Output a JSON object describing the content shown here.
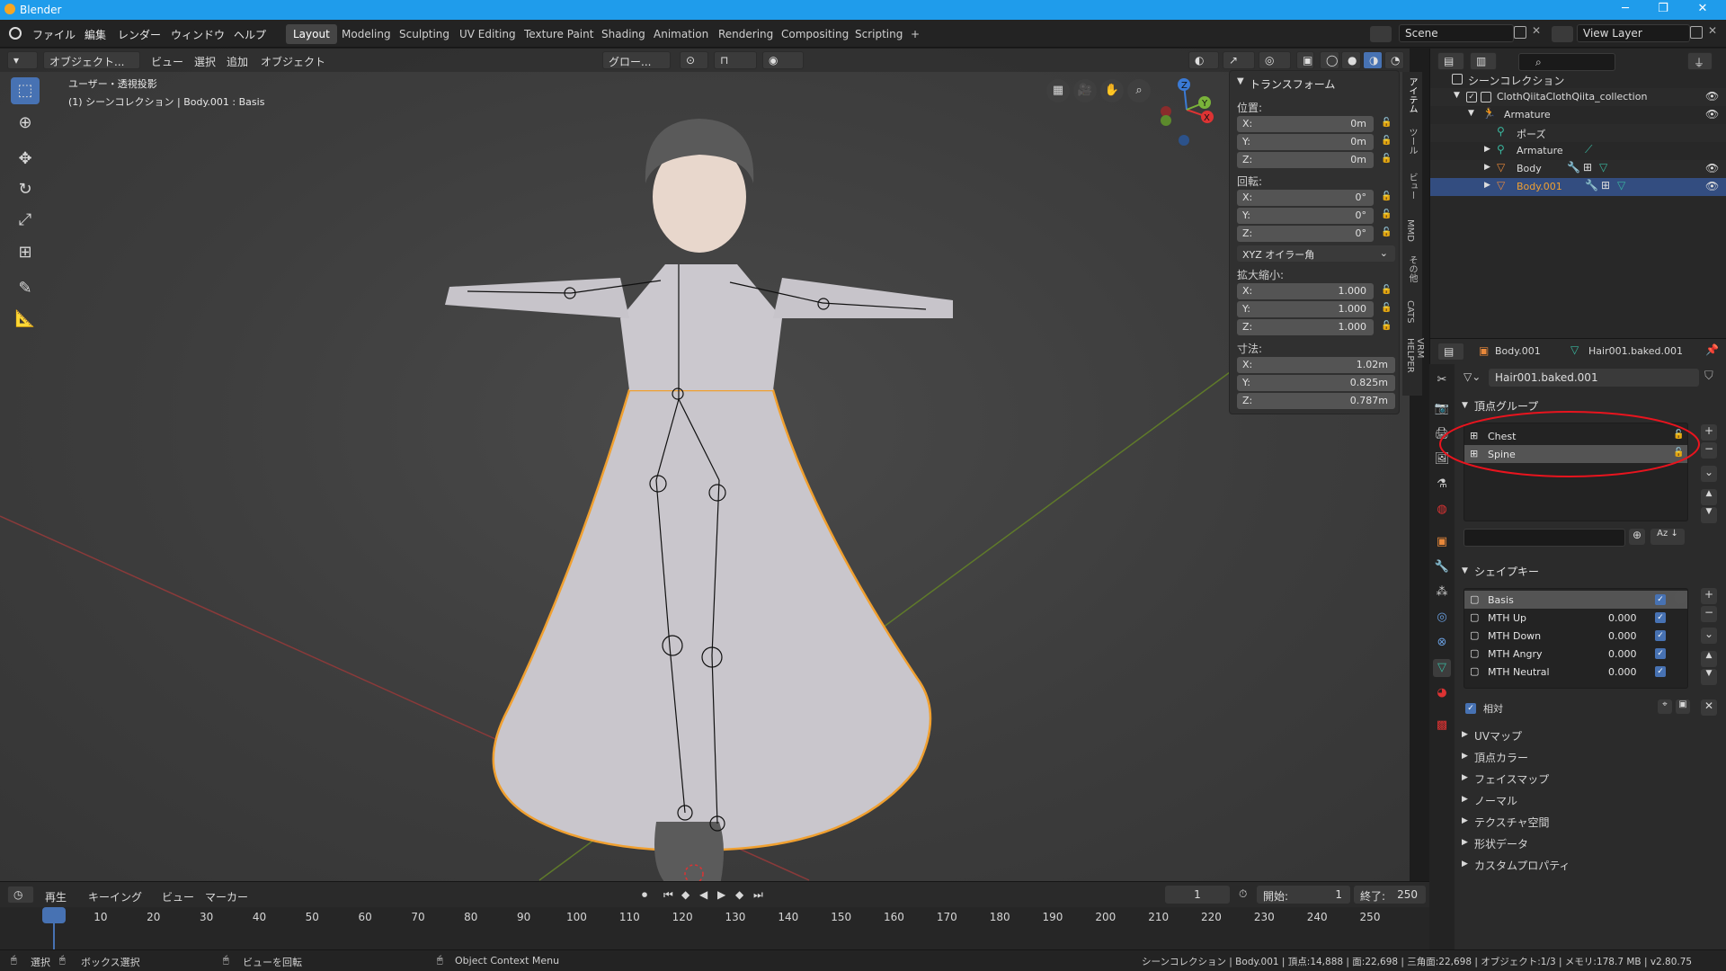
{
  "window": {
    "title": "Blender",
    "minimize": "─",
    "maximize": "❐",
    "close": "✕"
  },
  "menus": [
    "ファイル",
    "編集",
    "レンダー",
    "ウィンドウ",
    "ヘルプ"
  ],
  "workspaces": [
    "Layout",
    "Modeling",
    "Sculpting",
    "UV Editing",
    "Texture Paint",
    "Shading",
    "Animation",
    "Rendering",
    "Compositing",
    "Scripting",
    "+"
  ],
  "active_workspace": "Layout",
  "scene": {
    "name": "Scene",
    "view_layer": "View Layer"
  },
  "viewport_header": {
    "mode": "オブジェクト...",
    "view": "ビュー",
    "select": "選択",
    "add": "追加",
    "object": "オブジェクト",
    "transform_orientation": "グロー..."
  },
  "viewport_info": {
    "line1": "ユーザー・透視投影",
    "line2": "(1) シーンコレクション | Body.001 : Basis"
  },
  "gizmo": {
    "z": "Z",
    "y": "Y",
    "x": "X"
  },
  "transform_panel": {
    "title": "トランスフォーム",
    "location_label": "位置:",
    "location": [
      {
        "axis": "X:",
        "value": "0m"
      },
      {
        "axis": "Y:",
        "value": "0m"
      },
      {
        "axis": "Z:",
        "value": "0m"
      }
    ],
    "rotation_label": "回転:",
    "rotation": [
      {
        "axis": "X:",
        "value": "0°"
      },
      {
        "axis": "Y:",
        "value": "0°"
      },
      {
        "axis": "Z:",
        "value": "0°"
      }
    ],
    "rotation_mode": "XYZ オイラー角",
    "scale_label": "拡大縮小:",
    "scale": [
      {
        "axis": "X:",
        "value": "1.000"
      },
      {
        "axis": "Y:",
        "value": "1.000"
      },
      {
        "axis": "Z:",
        "value": "1.000"
      }
    ],
    "dimensions_label": "寸法:",
    "dimensions": [
      {
        "axis": "X:",
        "value": "1.02m"
      },
      {
        "axis": "Y:",
        "value": "0.825m"
      },
      {
        "axis": "Z:",
        "value": "0.787m"
      }
    ]
  },
  "sidebar_tabs": [
    "アイテム",
    "ツール",
    "ビュー",
    "MMD",
    "その他",
    "CATS",
    "VRM HELPER"
  ],
  "outliner": {
    "search_placeholder": "",
    "rows": [
      {
        "label": "シーンコレクション",
        "indent": 0,
        "icon": "collection-icon"
      },
      {
        "label": "ClothQiitaClothQiita_collection",
        "indent": 1,
        "icon": "collection-icon"
      },
      {
        "label": "Armature",
        "indent": 2,
        "icon": "armature-icon"
      },
      {
        "label": "ポーズ",
        "indent": 3,
        "icon": "pose-icon"
      },
      {
        "label": "Armature",
        "indent": 3,
        "icon": "armature-data-icon"
      },
      {
        "label": "Body",
        "indent": 3,
        "icon": "mesh-icon"
      },
      {
        "label": "Body.001",
        "indent": 3,
        "icon": "mesh-icon",
        "selected": true
      }
    ]
  },
  "properties": {
    "object_name": "Body.001",
    "mesh_name": "Hair001.baked.001",
    "data_name": "Hair001.baked.001",
    "vertex_groups_title": "頂点グループ",
    "vertex_groups": [
      "Chest",
      "Spine"
    ],
    "shape_keys_title": "シェイプキー",
    "shape_keys": [
      {
        "name": "Basis",
        "value": ""
      },
      {
        "name": "MTH Up",
        "value": "0.000"
      },
      {
        "name": "MTH Down",
        "value": "0.000"
      },
      {
        "name": "MTH Angry",
        "value": "0.000"
      },
      {
        "name": "MTH Neutral",
        "value": "0.000"
      }
    ],
    "relative_label": "相対",
    "collapsed_sections": [
      "UVマップ",
      "頂点カラー",
      "フェイスマップ",
      "ノーマル",
      "テクスチャ空間",
      "形状データ",
      "カスタムプロパティ"
    ]
  },
  "timeline": {
    "playback": "再生",
    "keying": "キーイング",
    "view": "ビュー",
    "marker": "マーカー",
    "current_frame": "1",
    "start_label": "開始:",
    "start": "1",
    "end_label": "終了:",
    "end": "250",
    "ticks": [
      "1",
      "10",
      "20",
      "30",
      "40",
      "50",
      "60",
      "70",
      "80",
      "90",
      "100",
      "110",
      "120",
      "130",
      "140",
      "150",
      "160",
      "170",
      "180",
      "190",
      "200",
      "210",
      "220",
      "230",
      "240",
      "250"
    ]
  },
  "statusbar": {
    "select": "選択",
    "box_select": "ボックス選択",
    "rotate_view": "ビューを回転",
    "context_menu": "Object Context Menu",
    "stats": "シーンコレクション | Body.001 | 頂点:14,888 | 面:22,698 | 三角面:22,698 | オブジェクト:1/3 | メモリ:178.7 MB | v2.80.75"
  },
  "colors": {
    "accent": "#4772b3",
    "title_bar": "#1f9ceb",
    "selection": "#334d80",
    "annotation": "#e8141e",
    "outline": "#f0a030"
  }
}
